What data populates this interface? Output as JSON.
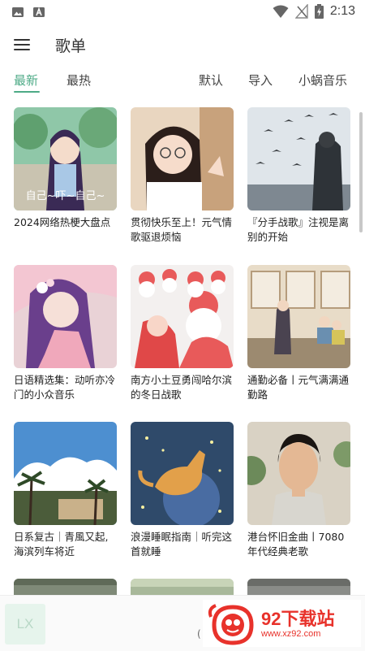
{
  "status": {
    "time": "2:13"
  },
  "header": {
    "title": "歌单"
  },
  "tabs": [
    {
      "label": "最新"
    },
    {
      "label": "最热"
    },
    {
      "label": "默认"
    },
    {
      "label": "导入"
    },
    {
      "label": "小蜗音乐"
    }
  ],
  "playlists": [
    {
      "title": "2024网络热梗大盘点",
      "cover_text": "自己~吓~自己~"
    },
    {
      "title": "贯彻快乐至上！元气情歌驱退烦恼"
    },
    {
      "title": "『分手战歌』注视是离别的开始"
    },
    {
      "title": "日语精选集：动听亦冷门的小众音乐"
    },
    {
      "title": "南方小土豆勇闯哈尔滨的冬日战歌"
    },
    {
      "title": "通勤必备丨元气满满通勤路"
    },
    {
      "title": "日系复古｜青風又起,海滨列车将近"
    },
    {
      "title": "浪漫睡眠指南｜听完这首就睡"
    },
    {
      "title": "港台怀旧金曲丨7080年代经典老歌"
    }
  ],
  "player": {
    "logo_text": "LX",
    "paren": "("
  },
  "watermark": {
    "name": "92下载站",
    "url": "www.xz92.com"
  },
  "colors": {
    "accent": "#4daa86",
    "watermark": "#e8322b"
  }
}
